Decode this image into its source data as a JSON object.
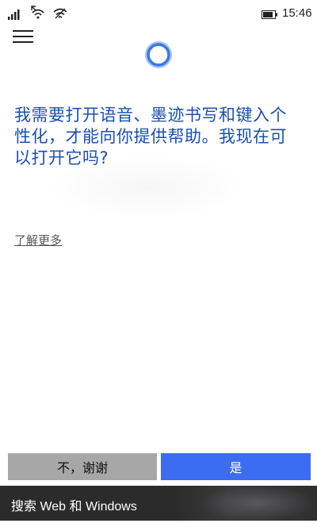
{
  "status_bar": {
    "time": "15:46",
    "icons": [
      "signal-bars-icon",
      "wifi-icon",
      "wifi-calling-icon",
      "battery-icon"
    ]
  },
  "header": {
    "menu_icon": "hamburger-menu-icon",
    "assistant_icon": "cortana-ring-icon"
  },
  "message": {
    "text": "我需要打开语音、墨迹书写和键入个性化，才能向你提供帮助。我现在可以打开它吗?",
    "learn_more": "了解更多"
  },
  "buttons": {
    "no_label": "不，谢谢",
    "yes_label": "是"
  },
  "search_bar": {
    "text": "搜索 Web 和 Windows"
  },
  "colors": {
    "accent": "#3c6cf2",
    "prompt_text": "#1b4fb0",
    "secondary_button": "#a7a7a7",
    "search_bar": "#2b2b2b",
    "cortana_ring": "#3a78e8"
  }
}
